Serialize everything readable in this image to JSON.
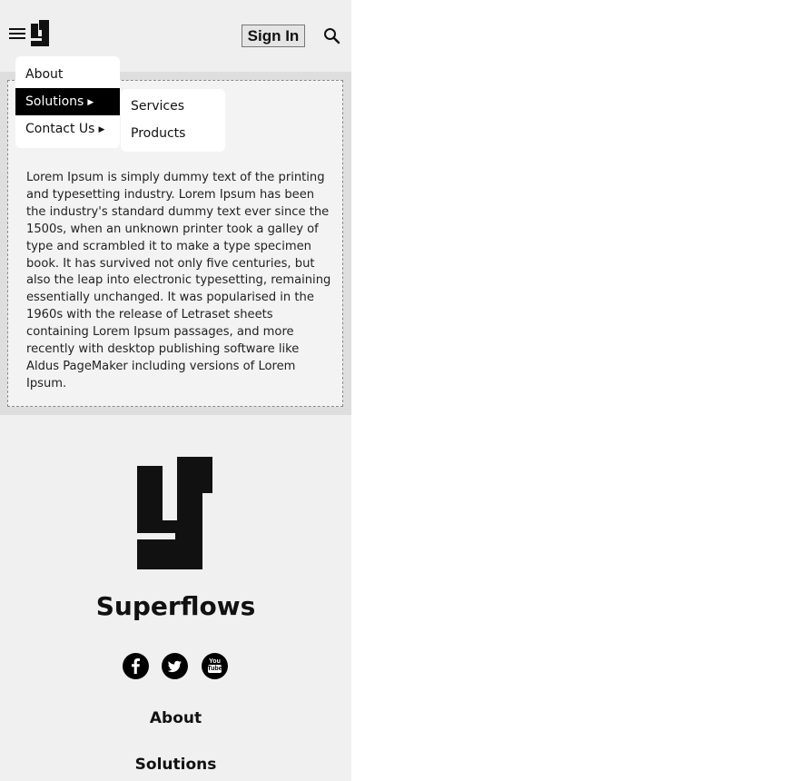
{
  "header": {
    "signin_label": "Sign In"
  },
  "nav_menu": {
    "items": [
      {
        "label": "About"
      },
      {
        "label": "Solutions"
      },
      {
        "label": "Contact Us"
      }
    ],
    "active_item": "Solutions",
    "submenu_items": [
      {
        "label": "Services"
      },
      {
        "label": "Products"
      }
    ]
  },
  "main": {
    "body_text": "Lorem Ipsum is simply dummy text of the printing and typesetting industry. Lorem Ipsum has been the industry's standard dummy text ever since the 1500s, when an unknown printer took a galley of type and scrambled it to make a type specimen book. It has survived not only five centuries, but also the leap into electronic typesetting, remaining essentially unchanged. It was popularised in the 1960s with the release of Letraset sheets containing Lorem Ipsum passages, and more recently with desktop publishing software like Aldus PageMaker including versions of Lorem Ipsum."
  },
  "footer": {
    "brand_name": "Superflows",
    "social_icons": [
      "facebook-icon",
      "twitter-icon",
      "youtube-icon"
    ],
    "links": [
      {
        "label": "About"
      },
      {
        "label": "Solutions"
      }
    ]
  },
  "icons": [
    "menu-icon",
    "logo-icon",
    "search-icon",
    "caret-right-icon"
  ],
  "colors": {
    "page_background": "#f0f0f0",
    "content_band": "#dedede",
    "active_menu_bg": "#000000",
    "active_menu_text": "#ffffff"
  }
}
